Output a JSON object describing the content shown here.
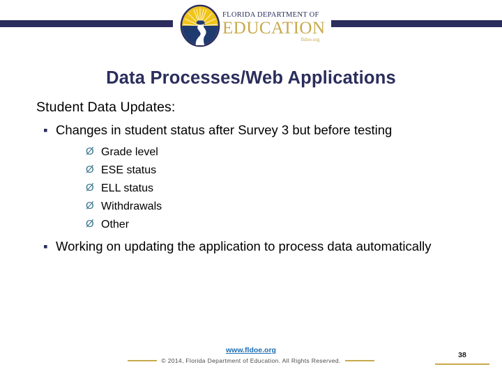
{
  "header": {
    "logo": {
      "seal_name": "florida-doe-seal",
      "line1": "FLORIDA DEPARTMENT OF",
      "line2": "EDUCATION",
      "line3": "fldoe.org"
    },
    "rule_color": "#2b2d5c"
  },
  "slide": {
    "title": "Data Processes/Web Applications",
    "lead": "Student Data Updates:",
    "bullet_glyph": "▪",
    "sub_glyph": "Ø",
    "bullets": [
      {
        "text": "Changes in student status after Survey 3 but before testing",
        "subitems": [
          "Grade level",
          "ESE status",
          "ELL status",
          "Withdrawals",
          "Other"
        ]
      },
      {
        "text": "Working on updating the application to process data automatically",
        "subitems": []
      }
    ]
  },
  "footer": {
    "link": "www.fldoe.org",
    "copyright": "© 2014, Florida Department of Education. All Rights Reserved.",
    "page_number": "38",
    "accent_color": "#c8a94b"
  },
  "colors": {
    "navy": "#2b2d5c",
    "gold": "#c8a94b",
    "teal": "#35738c",
    "link_blue": "#1f6fb5"
  }
}
